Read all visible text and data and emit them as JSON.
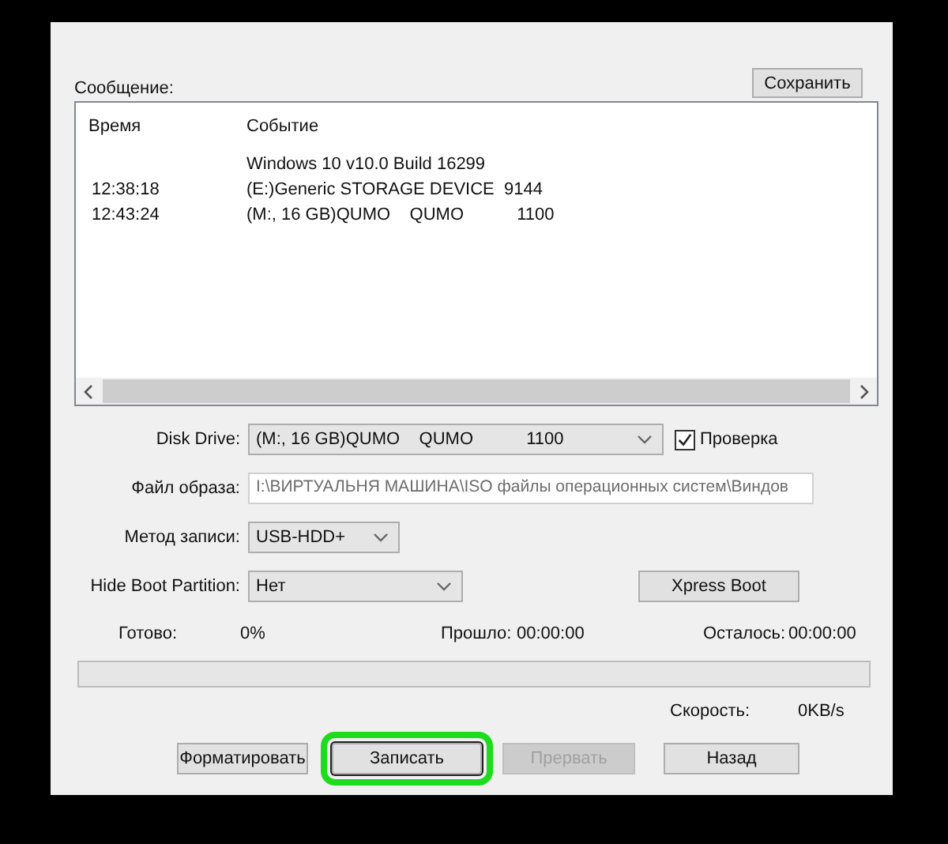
{
  "log": {
    "label": "Сообщение:",
    "save_button": "Сохранить",
    "columns": [
      "Время",
      "Событие"
    ],
    "rows": [
      {
        "time": "",
        "event": "Windows 10 v10.0 Build 16299"
      },
      {
        "time": "12:38:18",
        "event": "(E:)Generic STORAGE DEVICE  9144"
      },
      {
        "time": "12:43:24",
        "event": "(M:, 16 GB)QUMO    QUMO           1100"
      }
    ]
  },
  "form": {
    "disk_drive": {
      "label": "Disk Drive:",
      "value": "(M:, 16 GB)QUMO    QUMO           1100"
    },
    "verify": {
      "label": "Проверка",
      "checked": true
    },
    "image_file": {
      "label": "Файл образа:",
      "value": "I:\\ВИРТУАЛЬНЯ МАШИНА\\ISO файлы операционных систем\\Виндов"
    },
    "write_method": {
      "label": "Метод записи:",
      "value": "USB-HDD+"
    },
    "hide_boot": {
      "label": "Hide Boot Partition:",
      "value": "Нет"
    },
    "xpress_button": "Xpress Boot"
  },
  "stats": {
    "done_label": "Готово:",
    "done": "0%",
    "elapsed_label": "Прошло:",
    "elapsed": "00:00:00",
    "remaining_label": "Осталось:",
    "remaining": "00:00:00"
  },
  "progress": {
    "level": 0
  },
  "speed": {
    "label": "Скорость:",
    "value": "0KB/s"
  },
  "buttons": [
    {
      "label": "Форматировать",
      "disabled": false,
      "highlighted": false
    },
    {
      "label": "Записать",
      "disabled": false,
      "highlighted": true
    },
    {
      "label": "Прервать",
      "disabled": true,
      "highlighted": false
    },
    {
      "label": "Назад",
      "disabled": false,
      "highlighted": false
    }
  ]
}
